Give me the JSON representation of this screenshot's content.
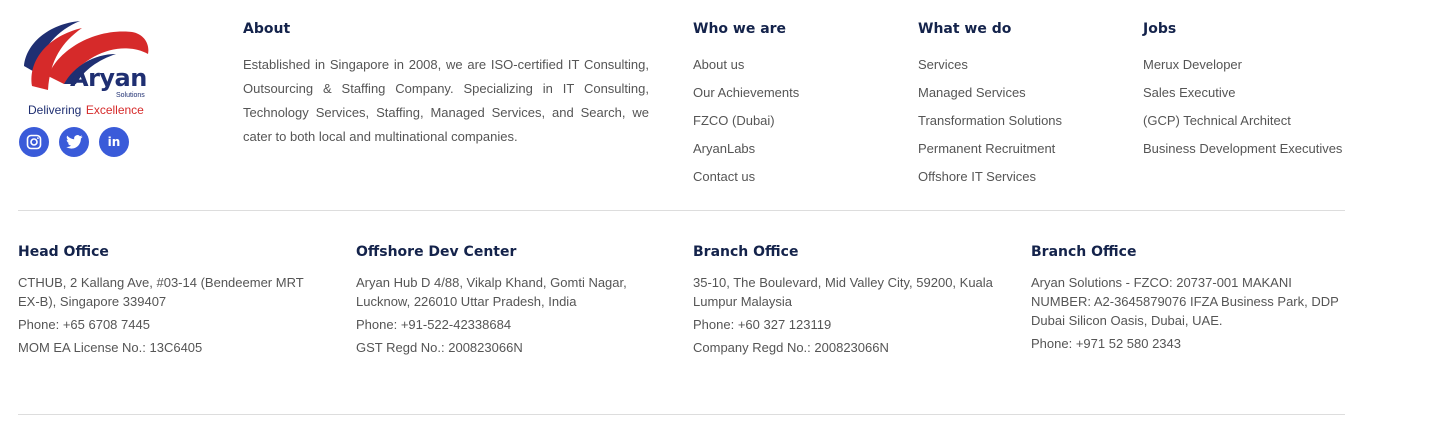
{
  "brand": {
    "name": "Aryan",
    "sub": "Solutions",
    "tagline_part1": "Delivering",
    "tagline_part2": "Excellence",
    "colors": {
      "navy": "#1f2f72",
      "red": "#d62a2a",
      "social": "#3a5bd9"
    }
  },
  "social": [
    {
      "icon": "instagram-icon"
    },
    {
      "icon": "twitter-icon"
    },
    {
      "icon": "linkedin-icon",
      "glyph": "in"
    }
  ],
  "about": {
    "title": "About",
    "text": "Established in Singapore in 2008, we are ISO-certified IT Consulting, Outsourcing & Staffing Company. Specializing in IT Consulting, Technology Services, Staffing, Managed Services, and Search, we cater to both local and multinational companies."
  },
  "who_we_are": {
    "title": "Who we are",
    "links": [
      "About us",
      "Our Achievements",
      "FZCO (Dubai)",
      "AryanLabs",
      "Contact us"
    ]
  },
  "what_we_do": {
    "title": "What we do",
    "links": [
      "Services",
      "Managed Services",
      "Transformation Solutions",
      "Permanent Recruitment",
      "Offshore IT Services"
    ]
  },
  "jobs": {
    "title": "Jobs",
    "links": [
      "Merux Developer",
      "Sales Executive",
      "(GCP) Technical Architect",
      "Business Development Executives"
    ]
  },
  "offices": [
    {
      "title": "Head Office",
      "address": "CTHUB, 2 Kallang Ave, #03-14 (Bendeemer MRT EX-B), Singapore 339407",
      "lines": [
        "Phone: +65 6708 7445",
        "MOM EA License No.: 13C6405"
      ]
    },
    {
      "title": "Offshore Dev Center",
      "address": "Aryan Hub D 4/88, Vikalp Khand, Gomti Nagar, Lucknow, 226010 Uttar Pradesh, India",
      "lines": [
        "Phone: +91-522-42338684",
        "GST Regd No.: 200823066N"
      ]
    },
    {
      "title": "Branch Office",
      "address": "35-10, The Boulevard, Mid Valley City, 59200, Kuala Lumpur Malaysia",
      "lines": [
        "Phone: +60 327 123119",
        "Company Regd No.: 200823066N"
      ]
    },
    {
      "title": "Branch Office",
      "address": "Aryan Solutions - FZCO: 20737-001 MAKANI NUMBER: A2-3645879076 IFZA Business Park, DDP Dubai Silicon Oasis, Dubai, UAE.",
      "lines": [
        "Phone: +971 52 580 2343"
      ]
    }
  ]
}
